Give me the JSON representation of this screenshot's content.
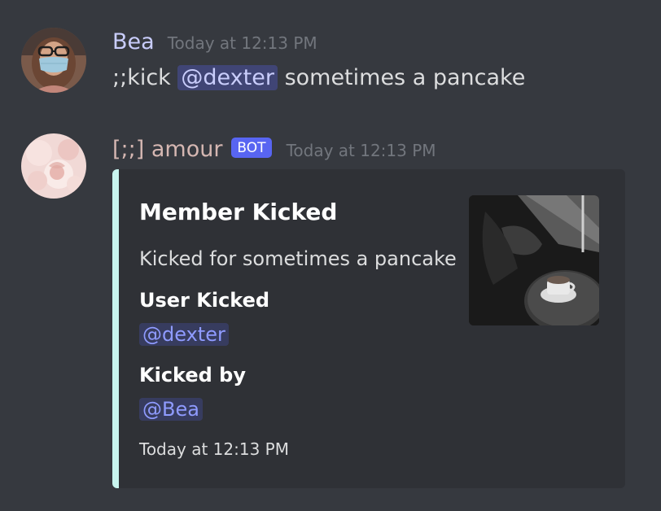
{
  "messages": [
    {
      "author": "Bea",
      "timestamp": "Today at 12:13 PM",
      "content_prefix": ";;kick",
      "mention": "@dexter",
      "content_suffix": "sometimes a pancake",
      "avatar_icon": "user-avatar-masked-woman"
    },
    {
      "author": "[;;] amour",
      "bot_tag": "BOT",
      "timestamp": "Today at 12:13 PM",
      "avatar_icon": "bot-avatar-pink-flowers",
      "embed": {
        "accent_color": "#c8f5ef",
        "title": "Member Kicked",
        "description": "Kicked for sometimes a pancake",
        "fields": [
          {
            "name": "User Kicked",
            "value": "@dexter"
          },
          {
            "name": "Kicked by",
            "value": "@Bea"
          }
        ],
        "footer": "Today at 12:13 PM",
        "thumbnail_icon": "coffee-cup-photo"
      }
    }
  ],
  "colors": {
    "background": "#36393f",
    "embed_background": "#2f3136",
    "bot_tag": "#5865f2",
    "user_name": "#c9cdfb",
    "bot_name": "#d5b7b2",
    "mention_text": "#8f9bff"
  }
}
